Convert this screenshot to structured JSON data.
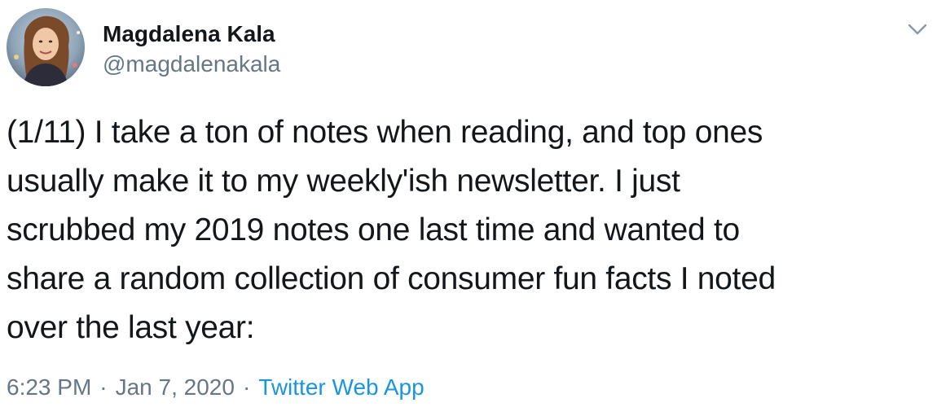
{
  "author": {
    "display_name": "Magdalena Kala",
    "handle": "@magdalenakala"
  },
  "tweet": {
    "text_lines": [
      "(1/11) I take a ton of notes when reading, and top ones",
      "usually make it to my weekly'ish newsletter. I just",
      "scrubbed my 2019 notes one last time and wanted to",
      "share a random collection of consumer fun facts I noted",
      "over the last year:"
    ]
  },
  "meta": {
    "time": "6:23 PM",
    "separator": "·",
    "date": "Jan 7, 2020",
    "source": "Twitter Web App"
  },
  "icons": {
    "more": "chevron-down-icon"
  },
  "colors": {
    "text_primary": "#14171a",
    "text_secondary": "#657786",
    "link": "#1b95e0"
  }
}
